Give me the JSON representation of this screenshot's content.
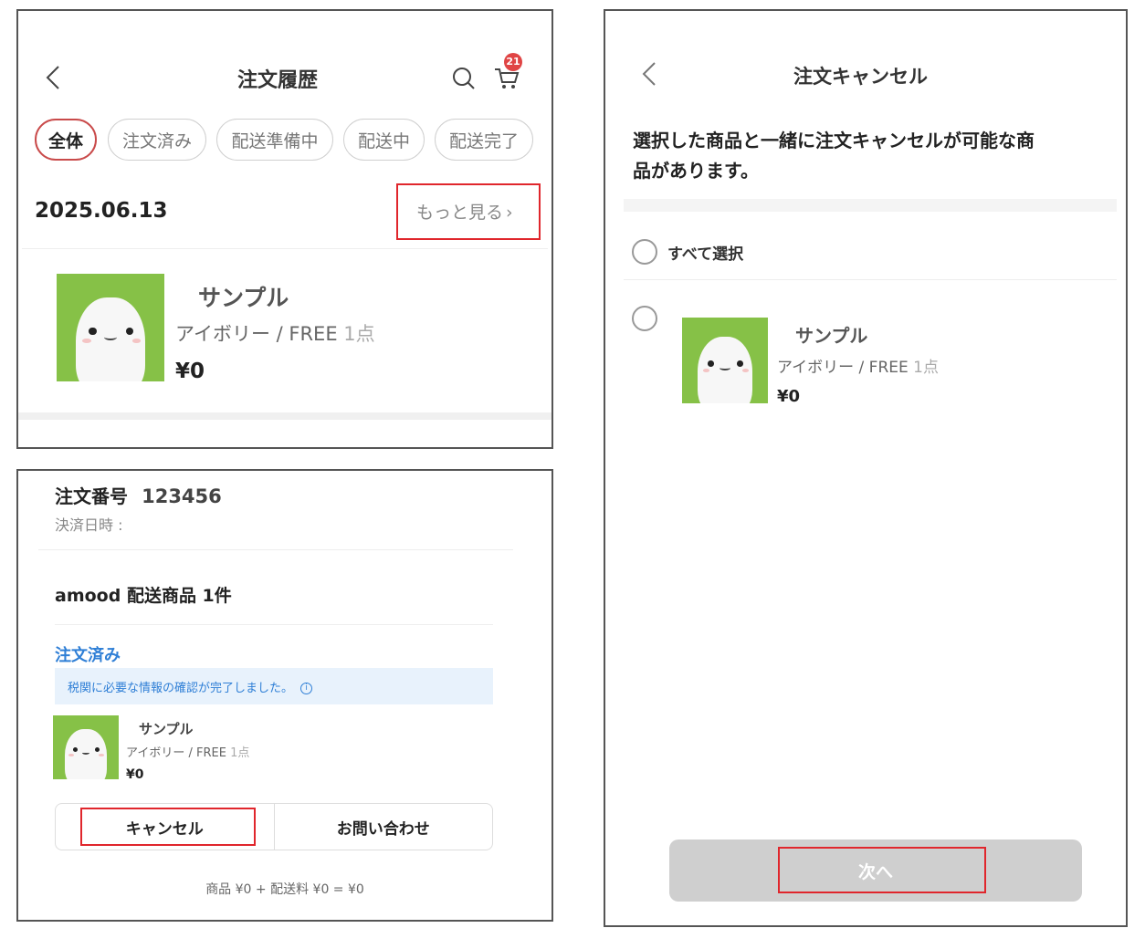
{
  "order_history": {
    "title": "注文履歴",
    "cart_count": "21",
    "tabs": [
      "全体",
      "注文済み",
      "配送準備中",
      "配送中",
      "配送完了"
    ],
    "date": "2025.06.13",
    "more_link": "もっと見る",
    "more_chevron": "›",
    "product": {
      "name": "サンプル",
      "option": "アイボリー / FREE",
      "qty": "1点",
      "price": "¥0"
    }
  },
  "order_detail": {
    "order_no_label": "注文番号",
    "order_no": "123456",
    "payment_date_label": "決済日時 :",
    "shipment_title": "amood 配送商品 1件",
    "status": "注文済み",
    "notice": "税関に必要な情報の確認が完了しました。",
    "product": {
      "name": "サンプル",
      "option": "アイボリー / FREE",
      "qty": "1点",
      "price": "¥0"
    },
    "cancel_label": "キャンセル",
    "inquiry_label": "お問い合わせ",
    "summary": "商品 ¥0 + 配送料 ¥0 = ¥0"
  },
  "cancel_screen": {
    "title": "注文キャンセル",
    "heading_line1": "選択した商品と一緒に注文キャンセルが可能な商",
    "heading_line2": "品があります。",
    "select_all": "すべて選択",
    "product": {
      "name": "サンプル",
      "option": "アイボリー / FREE",
      "qty": "1点",
      "price": "¥0"
    },
    "next_label": "次へ"
  },
  "colors": {
    "highlight": "#e0262c",
    "status_blue": "#2f7fd6",
    "badge": "#e04545",
    "product_bg": "#86c147"
  }
}
